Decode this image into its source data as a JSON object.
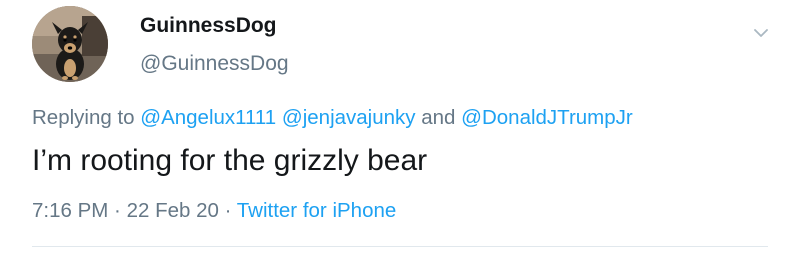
{
  "tweet": {
    "author": {
      "display_name": "GuinnessDog",
      "handle": "@GuinnessDog",
      "avatar_icon": "dog-photo-avatar"
    },
    "menu_icon": "chevron-down-icon",
    "reply": {
      "prefix": "Replying to ",
      "mentions": [
        "@Angelux1111",
        "@jenjavajunky"
      ],
      "conjunction": " and ",
      "last_mention": "@DonaldJTrumpJr"
    },
    "text": "I’m rooting for the grizzly bear",
    "time": "7:16 PM",
    "separator": " · ",
    "date": "22 Feb 20",
    "source": "Twitter for iPhone"
  },
  "colors": {
    "link": "#1da1f2",
    "secondary_text": "#657786",
    "primary_text": "#14171a",
    "divider": "#e1e8ed"
  }
}
